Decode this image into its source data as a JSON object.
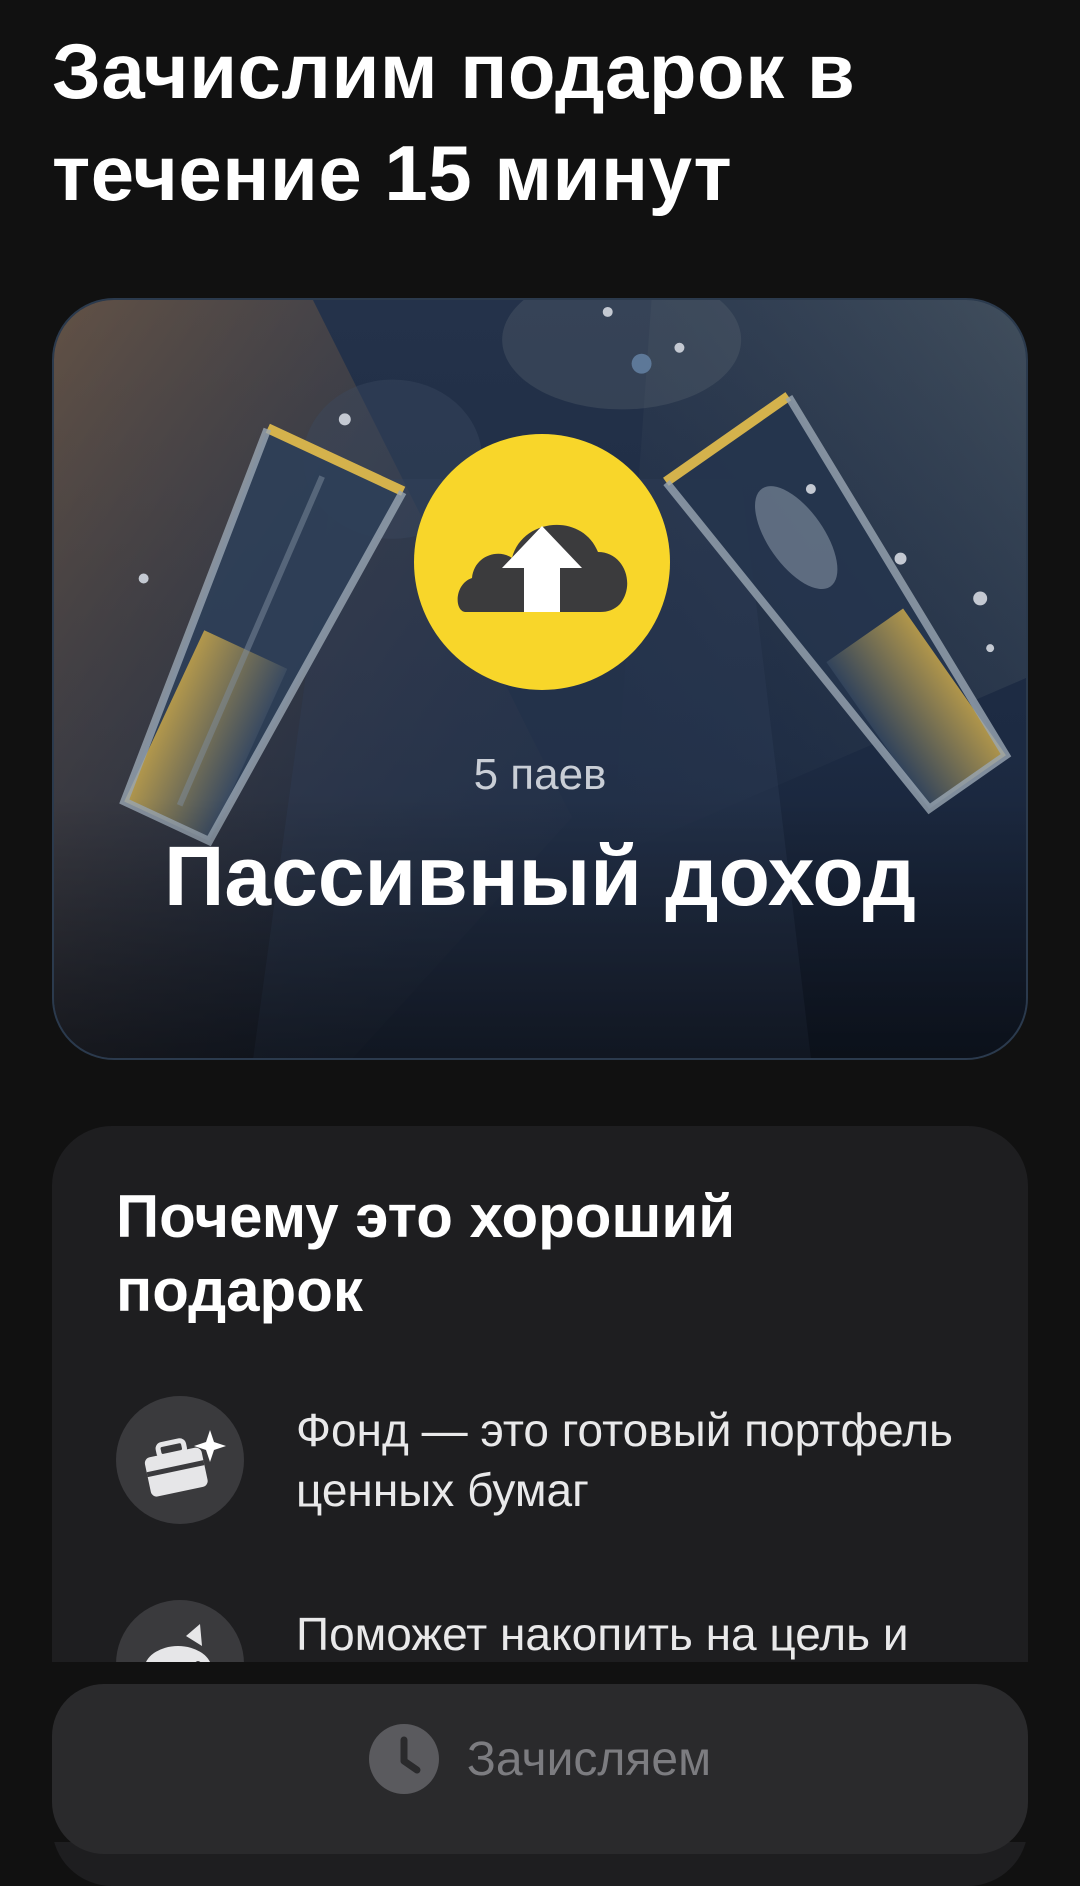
{
  "header": {
    "title": "Зачислим подарок в течение 15 минут"
  },
  "hero": {
    "subtitle": "5 паев",
    "title": "Пассивный доход",
    "logo_icon": "cloud-up-arrow-icon",
    "colors": {
      "logo_yellow": "#f8d62a",
      "card_bg": "#1b2a40",
      "glass_accent": "#c9a74a"
    }
  },
  "info": {
    "heading": "Почему это хороший подарок",
    "items": [
      {
        "icon": "briefcase-sparkle-icon",
        "text": "Фонд — это готовый портфель ценных бумаг"
      },
      {
        "icon": "piggy-bank-icon",
        "text": "Поможет накопить на цель и защитить деньги"
      }
    ]
  },
  "status_button": {
    "icon": "clock-icon",
    "label": "Зачисляем"
  }
}
